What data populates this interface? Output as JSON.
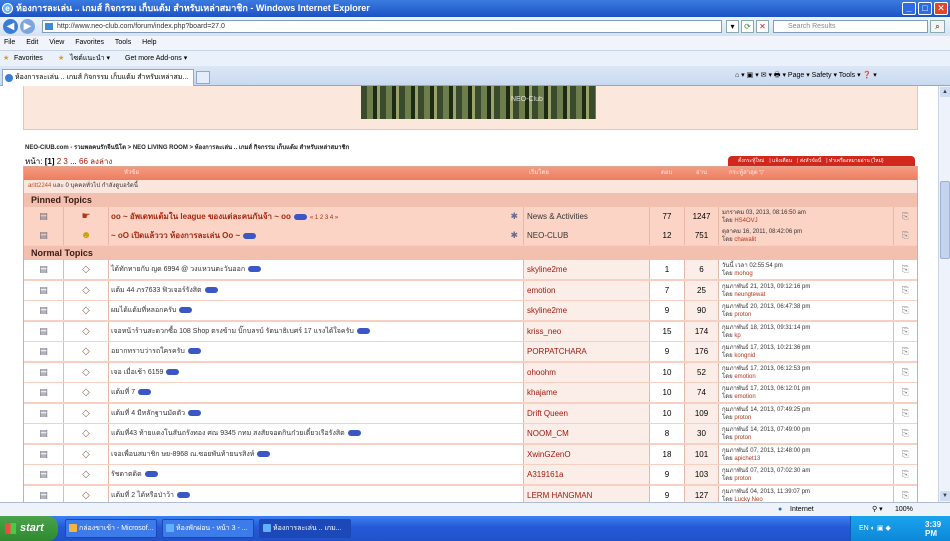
{
  "window": {
    "title": "ห้องการละเล่น .. เกมส์ กิจกรรม เก็บแต้ม สำหรับเหล่าสมาชิก - Windows Internet Explorer"
  },
  "address": {
    "url": "http://www.neo-club.com/forum/index.php?board=27.0",
    "search_placeholder": "Search Results"
  },
  "menu": [
    "File",
    "Edit",
    "View",
    "Favorites",
    "Tools",
    "Help"
  ],
  "favbar": {
    "favorites": "Favorites",
    "suggested": "ไซต์แนะนำ ▾",
    "addons": "Get more Add-ons ▾"
  },
  "tab": {
    "label": "ห้องการละเล่น .. เกมส์ กิจกรรม เก็บแต้ม สำหรับเหล่าสม...",
    "tools": "⌂ ▾  ▣ ▾  ✉  ▾  🖶 ▾  Page ▾  Safety ▾  Tools ▾  ❓ ▾"
  },
  "breadcrumb": "NEO-ClUB.com - รวมพลคนรักจีนนิโต > NEO LIVING ROOM > ห้องการละเล่น .. เกมส์ กิจกรรม เก็บแต้ม สำหรับเหล่าสมาชิก",
  "pages": {
    "label": "หน้า:",
    "current": "[1]",
    "p2": "2",
    "p3": "3",
    "dots": "...",
    "last": "66",
    "bottom": "ลงล่าง"
  },
  "actions": [
    "ตั้งกระทู้ใหม่",
    "แจ้งเตือน",
    "ส่งหัวข้อนี้",
    "ทำเครื่องหมายอ่าน (ใหม่)"
  ],
  "header": {
    "subject": "หัวข้อ",
    "starter": "เริ่มโดย",
    "replies": "ตอบ",
    "views": "อ่าน",
    "last_post": "กระทู้ล่าสุด ▽"
  },
  "online": {
    "user": "aritt2244",
    "text": " และ 0 บุคคลทั่วไป กำลังดูบอร์ดนี้"
  },
  "pinned_title": "Pinned Topics",
  "normal_title": "Normal Topics",
  "pinned": [
    {
      "subject": "oo ~ อัพเดทแต้มใน league ของแต่ละคนกันจ้า ~ oo",
      "pages": "« 1 2 3 4 »",
      "starter": "News & Activities",
      "replies": "77",
      "views": "1247",
      "last": "มกราคม 03, 2013, 08:16:50 am",
      "by": "HS4OVJ"
    },
    {
      "subject": "~ oO เปิดแล้ววว ห้องการละเล่น Oo ~",
      "pages": "",
      "starter": "NEO-CLUB",
      "replies": "12",
      "views": "751",
      "last": "ตุลาคม 16, 2011, 08:42:06 pm",
      "by": "chawalit"
    }
  ],
  "topics": [
    {
      "subject": "ได้ทักทายกับ ญด 6994 @ วงแหวนตะวันออก",
      "starter": "skyline2me",
      "replies": "1",
      "views": "6",
      "last": "วันนี้ เวลา 02:55:54 pm",
      "by": "mohog"
    },
    {
      "subject": "แต้ม 44 ภร7633 ฟิวเจอร์รังสิต",
      "starter": "emotion",
      "replies": "7",
      "views": "25",
      "last": "กุมภาพันธ์ 21, 2013, 09:12:16 pm",
      "by": "neungtewat"
    },
    {
      "subject": "ผมได้แต้มที่หลอกครับ",
      "starter": "skyline2me",
      "replies": "9",
      "views": "90",
      "last": "กุมภาพันธ์ 20, 2013, 06:47:38 pm",
      "by": "proton"
    },
    {
      "subject": "เจอหน้าร้านสะดวกซื้อ 108 Shop ตรงข้าม บิ๊กบลรบ์ รัตนาธิเบศร์ 17 แรงได้ใจครับ",
      "starter": "kriss_neo",
      "replies": "15",
      "views": "174",
      "last": "กุมภาพันธ์ 18, 2013, 09:31:14 pm",
      "by": "kp"
    },
    {
      "subject": "อยากทราบว่ารถใครครับ",
      "starter": "PORPATCHARA",
      "replies": "9",
      "views": "176",
      "last": "กุมภาพันธ์ 17, 2013, 10:21:36 pm",
      "by": "kongnid"
    },
    {
      "subject": "เจอ เมื่อเช้า 6159",
      "starter": "ohoohm",
      "replies": "10",
      "views": "52",
      "last": "กุมภาพันธ์ 17, 2013, 06:12:53 pm",
      "by": "emotion"
    },
    {
      "subject": "แต้มที่ 7",
      "starter": "khajame",
      "replies": "10",
      "views": "74",
      "last": "กุมภาพันธ์ 17, 2013, 06:12:01 pm",
      "by": "emotion"
    },
    {
      "subject": "แต้มที่ 4 มีหลักฐานมัดตัว",
      "starter": "Drift Queen",
      "replies": "10",
      "views": "109",
      "last": "กุมภาพันธ์ 14, 2013, 07:49:25 pm",
      "by": "proton"
    },
    {
      "subject": "แต้มที่43 ท้ายแดงโนสันถรังทอง ศณ 9345 กทม สงสัยจอดกินก๋วยเตี๋ยวเรือรังสิต",
      "starter": "NOOM_CM",
      "replies": "8",
      "views": "30",
      "last": "กุมภาพันธ์ 14, 2013, 07:49:00 pm",
      "by": "proton"
    },
    {
      "subject": "เจอเพื่อนสมาชิก ษย-8968 ณ.ซอยพันท้ายนรสิงห์",
      "starter": "XwinGZenO",
      "replies": "18",
      "views": "101",
      "last": "กุมภาพันธ์ 07, 2013, 12:48:00 pm",
      "by": "apichet13"
    },
    {
      "subject": "รัชดาตดิด",
      "starter": "A319161a",
      "replies": "9",
      "views": "103",
      "last": "กุมภาพันธ์ 07, 2013, 07:02:30 am",
      "by": "proton"
    },
    {
      "subject": "แต้มที่ 2 ได้หรือป่าว้า",
      "starter": "LERM HANGMAN",
      "replies": "9",
      "views": "127",
      "last": "กุมภาพันธ์ 04, 2013, 11:39:07 pm",
      "by": "Lucky Neo"
    }
  ],
  "by_prefix": "โดย",
  "status": {
    "zone": "Internet",
    "zoom": "100%"
  },
  "taskbar": {
    "start": "start",
    "tasks": [
      "กล่องขาเข้า - Microsof...",
      "ห้องพักผ่อน - หน้า 3 - ...",
      "ห้องการละเล่น .. เกม..."
    ],
    "lang": "EN",
    "clock": "3:39 PM"
  }
}
